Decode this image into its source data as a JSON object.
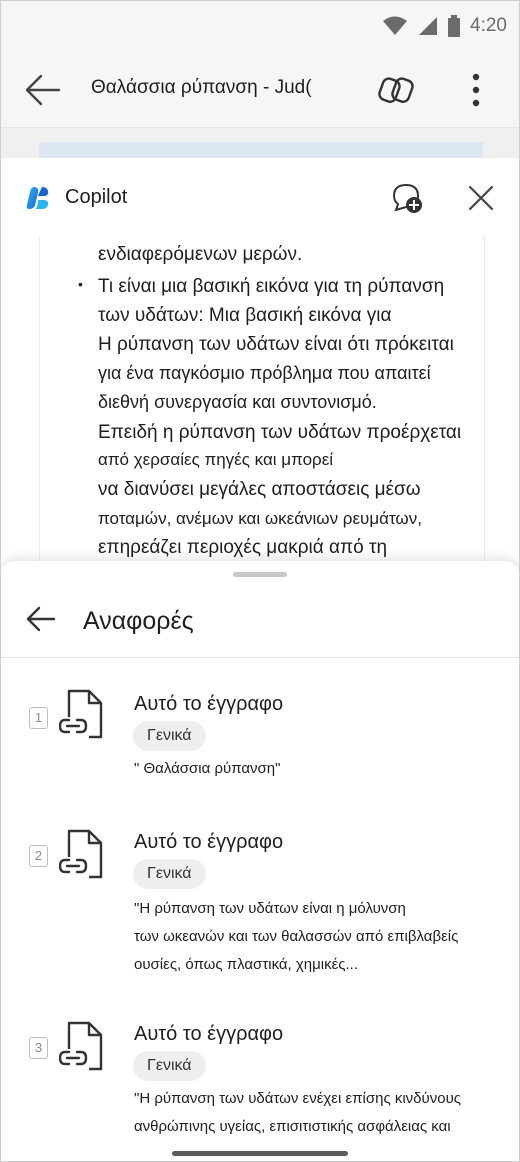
{
  "status_bar": {
    "time": "4:20",
    "wifi_icon": "wifi-icon",
    "signal_icon": "signal-icon",
    "battery_icon": "battery-icon"
  },
  "app_bar": {
    "title": "Θαλάσσια ρύπανση - Jud(",
    "back_icon": "arrow-left-icon",
    "copilot_icon": "copilot-icon",
    "more_icon": "more-vertical-icon"
  },
  "copilot_pane": {
    "label": "Copilot",
    "new_chat_icon": "new-chat-icon",
    "close_icon": "close-icon"
  },
  "document": {
    "lines": [
      "ενδιαφερόμενων μερών.",
      "Τι είναι μια βασική εικόνα για τη ρύπανση",
      "των υδάτων: Μια βασική εικόνα για",
      "Η ρύπανση των υδάτων είναι ότι πρόκειται",
      "για ένα παγκόσμιο πρόβλημα που απαιτεί",
      "διεθνή συνεργασία και συντονισμό.",
      "Επειδή η ρύπανση των υδάτων προέρχεται",
      "από χερσαίες πηγές και μπορεί",
      "να διανύσει μεγάλες αποστάσεις μέσω",
      "ποταμών, ανέμων και ωκεάνιων ρευμάτων,",
      "επηρεάζει περιοχές μακριά από τη"
    ]
  },
  "references": {
    "title": "Αναφορές",
    "back_icon": "arrow-left-icon",
    "items": [
      {
        "number": "1",
        "title": "Αυτό το έγγραφο",
        "tag": "Γενικά",
        "quote": [
          "\" Θαλάσσια ρύπανση\""
        ]
      },
      {
        "number": "2",
        "title": "Αυτό το έγγραφο",
        "tag": "Γενικά",
        "quote": [
          "\"Η ρύπανση των υδάτων είναι η μόλυνση",
          "των ωκεανών και των θαλασσών από επιβλαβείς",
          "ουσίες, όπως πλαστικά, χημικές..."
        ]
      },
      {
        "number": "3",
        "title": "Αυτό το έγγραφο",
        "tag": "Γενικά",
        "quote": [
          "\"Η ρύπανση των υδάτων ενέχει επίσης κινδύνους",
          "ανθρώπινης υγείας, επισιτιστικής ασφάλειας και"
        ]
      }
    ]
  }
}
